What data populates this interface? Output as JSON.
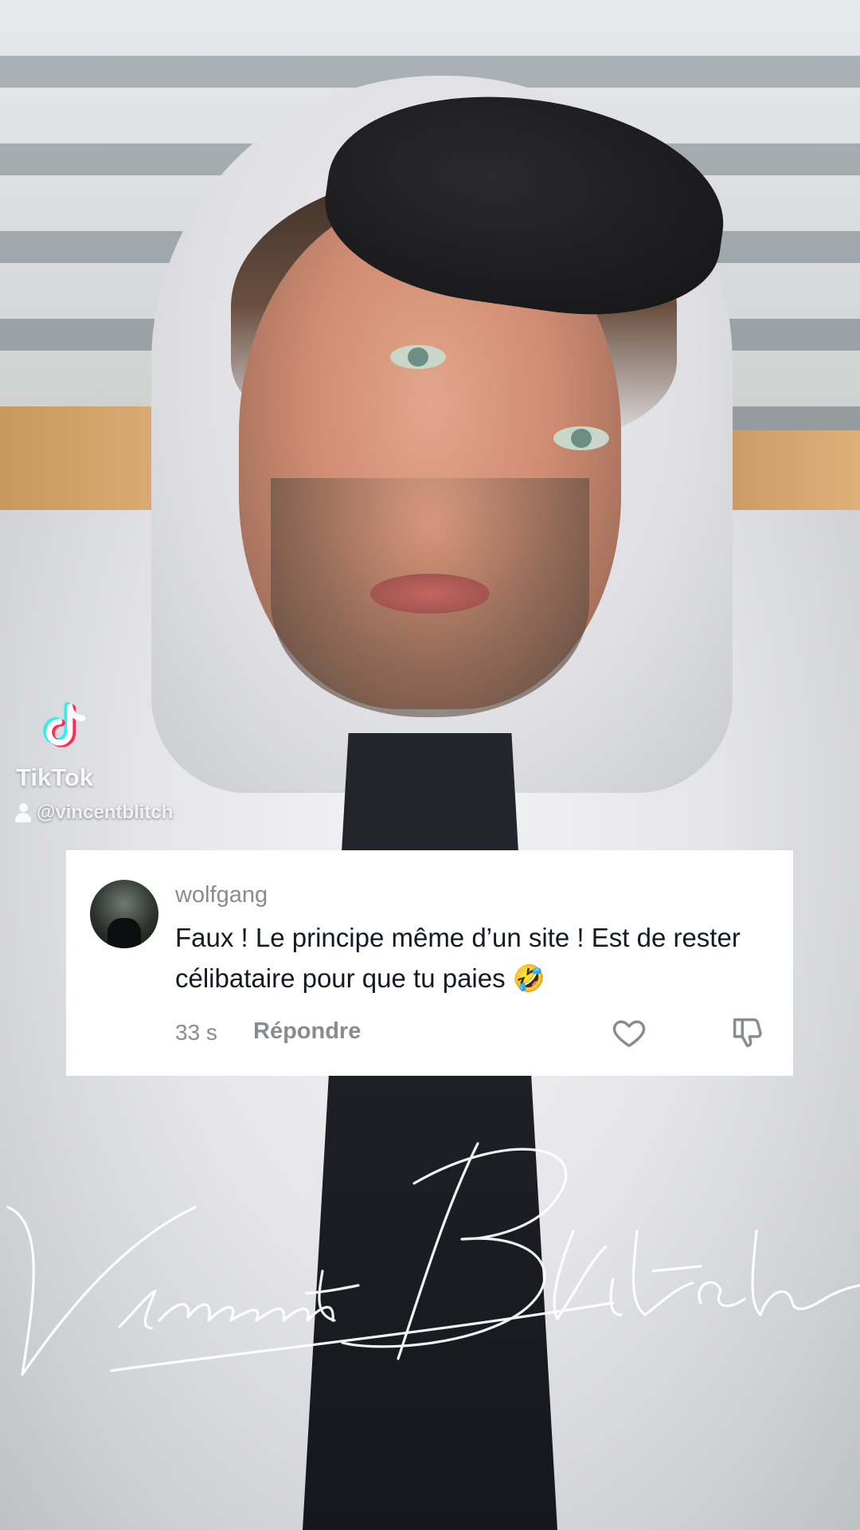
{
  "watermark": {
    "platform": "TikTok",
    "username": "@vincentblitch"
  },
  "comment": {
    "username": "wolfgang",
    "text": "Faux ! Le principe même d’un site ! Est de rester célibataire pour que tu paies 🤣",
    "time": "33 s",
    "reply_label": "Répondre"
  },
  "signature_overlay": {
    "text": "Vincent Blitch"
  },
  "colors": {
    "card_background": "#ffffff",
    "meta_text": "#8a8b91",
    "comment_text": "#161823",
    "tiktok_cyan": "#25F4EE",
    "tiktok_red": "#FE2C55"
  },
  "icons": {
    "like": "heart-icon",
    "dislike": "thumbs-down-icon",
    "watermark_logo": "tiktok-logo-icon",
    "watermark_user": "person-icon"
  }
}
